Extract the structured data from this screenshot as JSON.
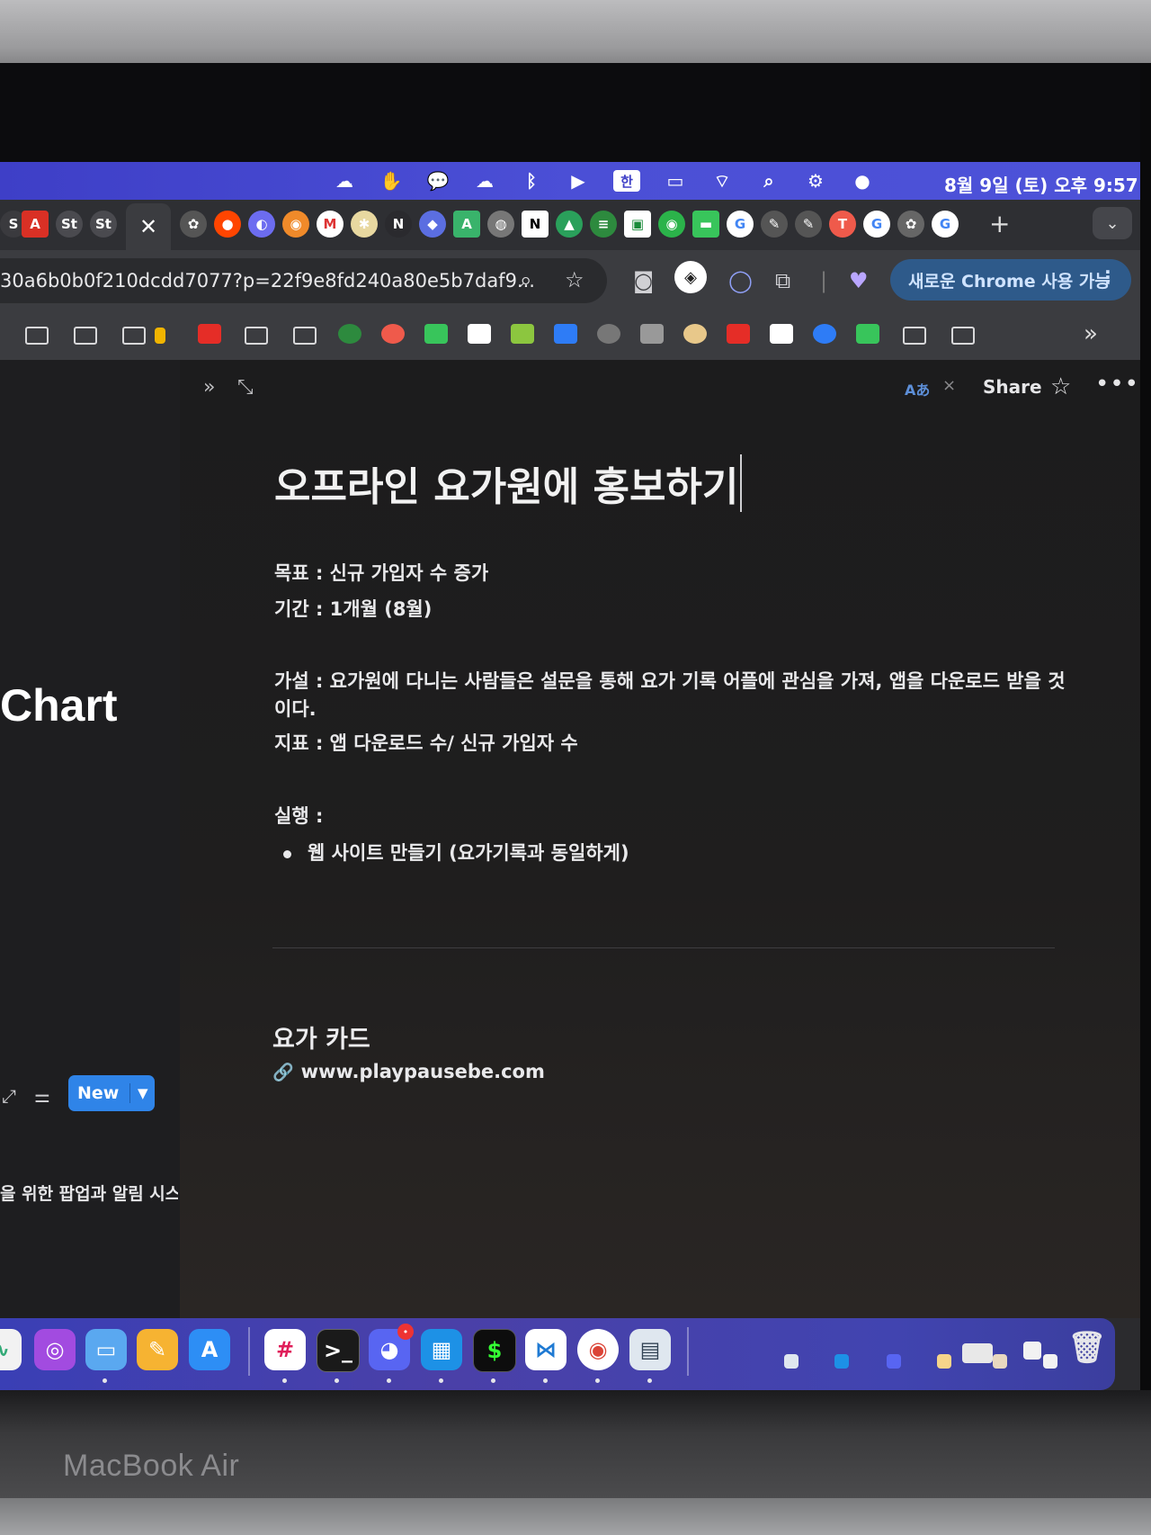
{
  "menubar": {
    "input_method": "한",
    "clock": "8월 9일 (토) 오후 9:57",
    "icons": [
      "creative-cloud-icon",
      "accessibility-icon",
      "messages-icon",
      "cloud-icon",
      "bluetooth-icon",
      "play-icon",
      "input-method-icon",
      "battery-icon",
      "wifi-icon",
      "search-icon",
      "control-center-icon",
      "siri-icon"
    ]
  },
  "tabs": {
    "close_label": "✕",
    "new_tab_label": "+",
    "tab_menu_label": "⌄"
  },
  "toolbar": {
    "url": "30a6b0b0f210dcdd7077?p=22f9e8fd240a80e5b7daf9...",
    "update_button": "새로운 Chrome 사용 가능"
  },
  "bookmarks": {
    "more_label": "»"
  },
  "sidebar": {
    "title": "Chart",
    "new_button": "New",
    "row_text": "을 위한 팝업과 알림 시스"
  },
  "page": {
    "topbar": {
      "lang_badge": "Aあ",
      "share_label": "Share"
    },
    "title": "오프라인 요가원에 홍보하기",
    "goal": "목표 : 신규 가입자 수 증가",
    "period": "기간 : 1개월 (8월)",
    "hypothesis": "가설 : 요가원에 다니는 사람들은 설문을 통해 요가 기록 어플에 관심을 가져, 앱을 다운로드 받을 것이다.",
    "metric": "지표 : 앱 다운로드 수/ 신규 가입자 수",
    "execution": "실행 :",
    "bullet": "웹 사이트 만들기 (요가기록과 동일하게)",
    "section_heading": "요가 카드",
    "link": "www.playpausebe.com"
  },
  "device": {
    "label": "MacBook Air"
  },
  "colors": {
    "menubar": "#4b4fd6",
    "new_button": "#2f84e8",
    "update_button": "#2e5a8a",
    "page_bg": "#1c1c1d"
  }
}
